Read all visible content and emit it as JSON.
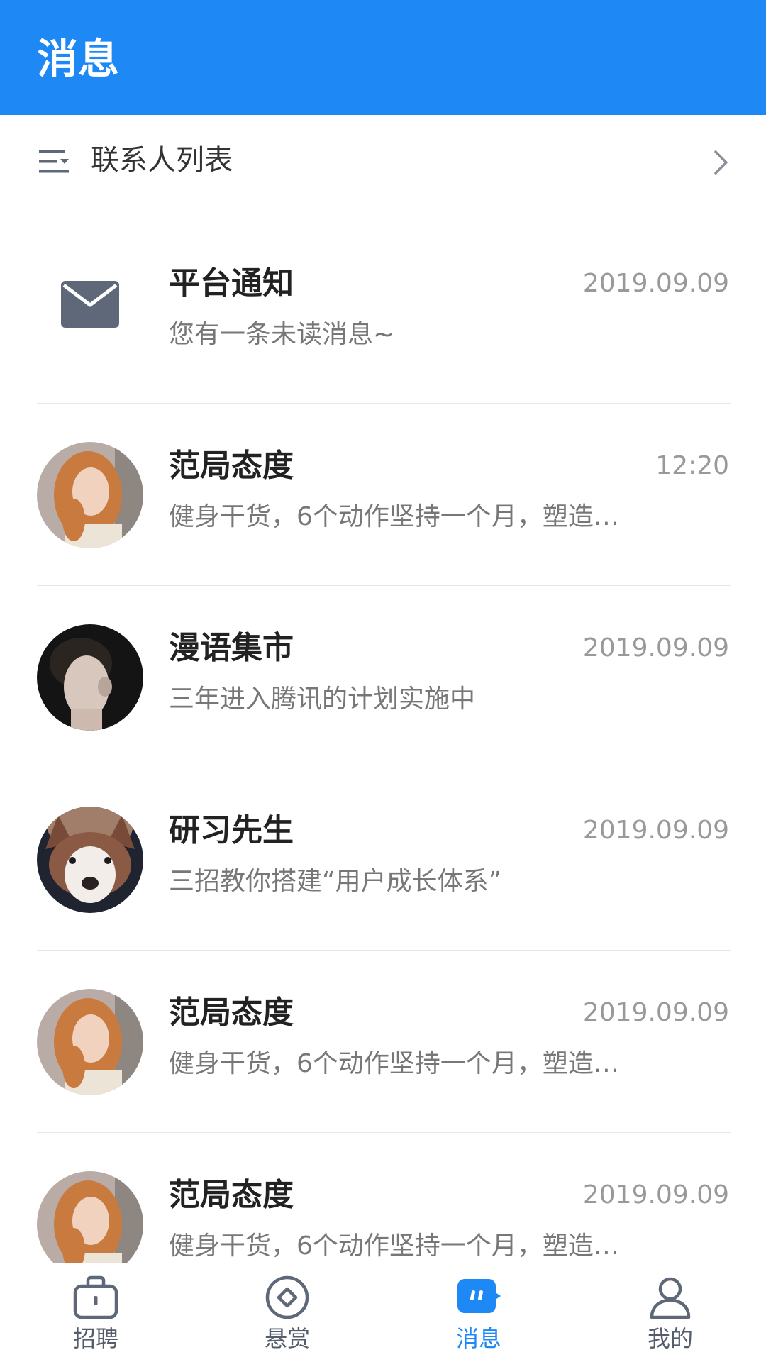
{
  "header": {
    "title": "消息"
  },
  "contacts": {
    "label": "联系人列表"
  },
  "messages": [
    {
      "name": "平台通知",
      "time": "2019.09.09",
      "preview": "您有一条未读消息~",
      "avatar": "mail-icon"
    },
    {
      "name": "范局态度",
      "time": "12:20",
      "preview": "健身干货，6个动作坚持一个月，塑造…",
      "avatar": "avatar-woman-red-hair"
    },
    {
      "name": "漫语集市",
      "time": "2019.09.09",
      "preview": "三年进入腾讯的计划实施中",
      "avatar": "avatar-man-profile"
    },
    {
      "name": "研习先生",
      "time": "2019.09.09",
      "preview": "三招教你搭建“用户成长体系”",
      "avatar": "avatar-husky-dog"
    },
    {
      "name": "范局态度",
      "time": "2019.09.09",
      "preview": "健身干货，6个动作坚持一个月，塑造…",
      "avatar": "avatar-woman-red-hair"
    },
    {
      "name": "范局态度",
      "time": "2019.09.09",
      "preview": "健身干货，6个动作坚持一个月，塑造…",
      "avatar": "avatar-woman-red-hair"
    }
  ],
  "tabs": [
    {
      "label": "招聘",
      "icon": "briefcase-icon"
    },
    {
      "label": "悬赏",
      "icon": "reward-icon"
    },
    {
      "label": "消息",
      "icon": "message-icon"
    },
    {
      "label": "我的",
      "icon": "user-icon"
    }
  ],
  "colors": {
    "primary": "#1e88f5",
    "icon_gray": "#5f6878",
    "text_dark": "#222222",
    "text_gray": "#777777",
    "time_gray": "#999999"
  }
}
